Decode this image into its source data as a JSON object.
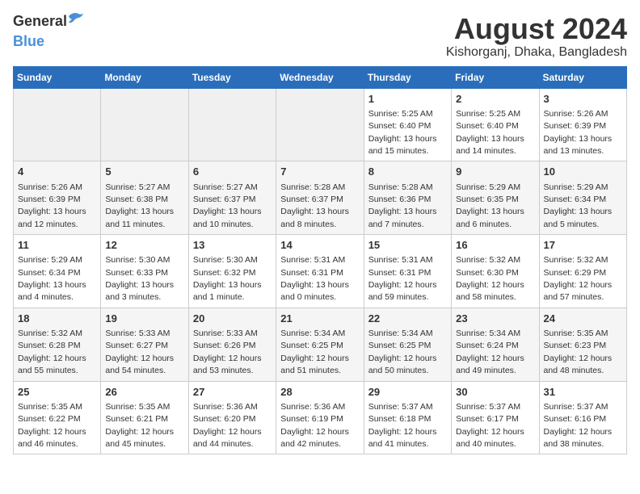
{
  "header": {
    "logo_general": "General",
    "logo_blue": "Blue",
    "title": "August 2024",
    "subtitle": "Kishorganj, Dhaka, Bangladesh"
  },
  "days_of_week": [
    "Sunday",
    "Monday",
    "Tuesday",
    "Wednesday",
    "Thursday",
    "Friday",
    "Saturday"
  ],
  "weeks": [
    [
      {
        "num": "",
        "info": "",
        "empty": true
      },
      {
        "num": "",
        "info": "",
        "empty": true
      },
      {
        "num": "",
        "info": "",
        "empty": true
      },
      {
        "num": "",
        "info": "",
        "empty": true
      },
      {
        "num": "1",
        "info": "Sunrise: 5:25 AM\nSunset: 6:40 PM\nDaylight: 13 hours\nand 15 minutes.",
        "empty": false
      },
      {
        "num": "2",
        "info": "Sunrise: 5:25 AM\nSunset: 6:40 PM\nDaylight: 13 hours\nand 14 minutes.",
        "empty": false
      },
      {
        "num": "3",
        "info": "Sunrise: 5:26 AM\nSunset: 6:39 PM\nDaylight: 13 hours\nand 13 minutes.",
        "empty": false
      }
    ],
    [
      {
        "num": "4",
        "info": "Sunrise: 5:26 AM\nSunset: 6:39 PM\nDaylight: 13 hours\nand 12 minutes.",
        "empty": false
      },
      {
        "num": "5",
        "info": "Sunrise: 5:27 AM\nSunset: 6:38 PM\nDaylight: 13 hours\nand 11 minutes.",
        "empty": false
      },
      {
        "num": "6",
        "info": "Sunrise: 5:27 AM\nSunset: 6:37 PM\nDaylight: 13 hours\nand 10 minutes.",
        "empty": false
      },
      {
        "num": "7",
        "info": "Sunrise: 5:28 AM\nSunset: 6:37 PM\nDaylight: 13 hours\nand 8 minutes.",
        "empty": false
      },
      {
        "num": "8",
        "info": "Sunrise: 5:28 AM\nSunset: 6:36 PM\nDaylight: 13 hours\nand 7 minutes.",
        "empty": false
      },
      {
        "num": "9",
        "info": "Sunrise: 5:29 AM\nSunset: 6:35 PM\nDaylight: 13 hours\nand 6 minutes.",
        "empty": false
      },
      {
        "num": "10",
        "info": "Sunrise: 5:29 AM\nSunset: 6:34 PM\nDaylight: 13 hours\nand 5 minutes.",
        "empty": false
      }
    ],
    [
      {
        "num": "11",
        "info": "Sunrise: 5:29 AM\nSunset: 6:34 PM\nDaylight: 13 hours\nand 4 minutes.",
        "empty": false
      },
      {
        "num": "12",
        "info": "Sunrise: 5:30 AM\nSunset: 6:33 PM\nDaylight: 13 hours\nand 3 minutes.",
        "empty": false
      },
      {
        "num": "13",
        "info": "Sunrise: 5:30 AM\nSunset: 6:32 PM\nDaylight: 13 hours\nand 1 minute.",
        "empty": false
      },
      {
        "num": "14",
        "info": "Sunrise: 5:31 AM\nSunset: 6:31 PM\nDaylight: 13 hours\nand 0 minutes.",
        "empty": false
      },
      {
        "num": "15",
        "info": "Sunrise: 5:31 AM\nSunset: 6:31 PM\nDaylight: 12 hours\nand 59 minutes.",
        "empty": false
      },
      {
        "num": "16",
        "info": "Sunrise: 5:32 AM\nSunset: 6:30 PM\nDaylight: 12 hours\nand 58 minutes.",
        "empty": false
      },
      {
        "num": "17",
        "info": "Sunrise: 5:32 AM\nSunset: 6:29 PM\nDaylight: 12 hours\nand 57 minutes.",
        "empty": false
      }
    ],
    [
      {
        "num": "18",
        "info": "Sunrise: 5:32 AM\nSunset: 6:28 PM\nDaylight: 12 hours\nand 55 minutes.",
        "empty": false
      },
      {
        "num": "19",
        "info": "Sunrise: 5:33 AM\nSunset: 6:27 PM\nDaylight: 12 hours\nand 54 minutes.",
        "empty": false
      },
      {
        "num": "20",
        "info": "Sunrise: 5:33 AM\nSunset: 6:26 PM\nDaylight: 12 hours\nand 53 minutes.",
        "empty": false
      },
      {
        "num": "21",
        "info": "Sunrise: 5:34 AM\nSunset: 6:25 PM\nDaylight: 12 hours\nand 51 minutes.",
        "empty": false
      },
      {
        "num": "22",
        "info": "Sunrise: 5:34 AM\nSunset: 6:25 PM\nDaylight: 12 hours\nand 50 minutes.",
        "empty": false
      },
      {
        "num": "23",
        "info": "Sunrise: 5:34 AM\nSunset: 6:24 PM\nDaylight: 12 hours\nand 49 minutes.",
        "empty": false
      },
      {
        "num": "24",
        "info": "Sunrise: 5:35 AM\nSunset: 6:23 PM\nDaylight: 12 hours\nand 48 minutes.",
        "empty": false
      }
    ],
    [
      {
        "num": "25",
        "info": "Sunrise: 5:35 AM\nSunset: 6:22 PM\nDaylight: 12 hours\nand 46 minutes.",
        "empty": false
      },
      {
        "num": "26",
        "info": "Sunrise: 5:35 AM\nSunset: 6:21 PM\nDaylight: 12 hours\nand 45 minutes.",
        "empty": false
      },
      {
        "num": "27",
        "info": "Sunrise: 5:36 AM\nSunset: 6:20 PM\nDaylight: 12 hours\nand 44 minutes.",
        "empty": false
      },
      {
        "num": "28",
        "info": "Sunrise: 5:36 AM\nSunset: 6:19 PM\nDaylight: 12 hours\nand 42 minutes.",
        "empty": false
      },
      {
        "num": "29",
        "info": "Sunrise: 5:37 AM\nSunset: 6:18 PM\nDaylight: 12 hours\nand 41 minutes.",
        "empty": false
      },
      {
        "num": "30",
        "info": "Sunrise: 5:37 AM\nSunset: 6:17 PM\nDaylight: 12 hours\nand 40 minutes.",
        "empty": false
      },
      {
        "num": "31",
        "info": "Sunrise: 5:37 AM\nSunset: 6:16 PM\nDaylight: 12 hours\nand 38 minutes.",
        "empty": false
      }
    ]
  ]
}
